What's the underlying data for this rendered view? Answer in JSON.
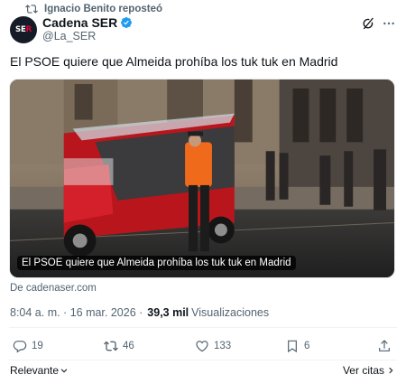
{
  "repost": {
    "text": "Ignacio Benito reposteó"
  },
  "author": {
    "name": "Cadena SER",
    "handle": "@La_SER",
    "avatar_text_white": "SE",
    "avatar_text_red": "R"
  },
  "tweet": {
    "text": "El PSOE quiere que Almeida prohíba los tuk tuk en Madrid"
  },
  "media": {
    "caption": "El PSOE quiere que Almeida prohíba los tuk tuk en Madrid"
  },
  "source": {
    "text": "De cadenaser.com"
  },
  "meta": {
    "time_date": "8:04 a. m. · 16 mar. 2026 ·",
    "views_count": "39,3 mil",
    "views_label": "Visualizaciones"
  },
  "actions": {
    "replies": "19",
    "reposts": "46",
    "likes": "133",
    "bookmarks": "6"
  },
  "footer": {
    "sort_label": "Relevante",
    "quotes_label": "Ver citas"
  },
  "colors": {
    "verified": "#1d9bf0",
    "muted": "#536471",
    "text": "#0f1419",
    "brand_red": "#e4003a"
  },
  "icons": [
    "repost-icon",
    "verified-icon",
    "grok-icon",
    "more-icon",
    "reply-icon",
    "like-icon",
    "bookmark-icon",
    "share-icon",
    "chevron-down-icon",
    "chevron-right-icon"
  ]
}
